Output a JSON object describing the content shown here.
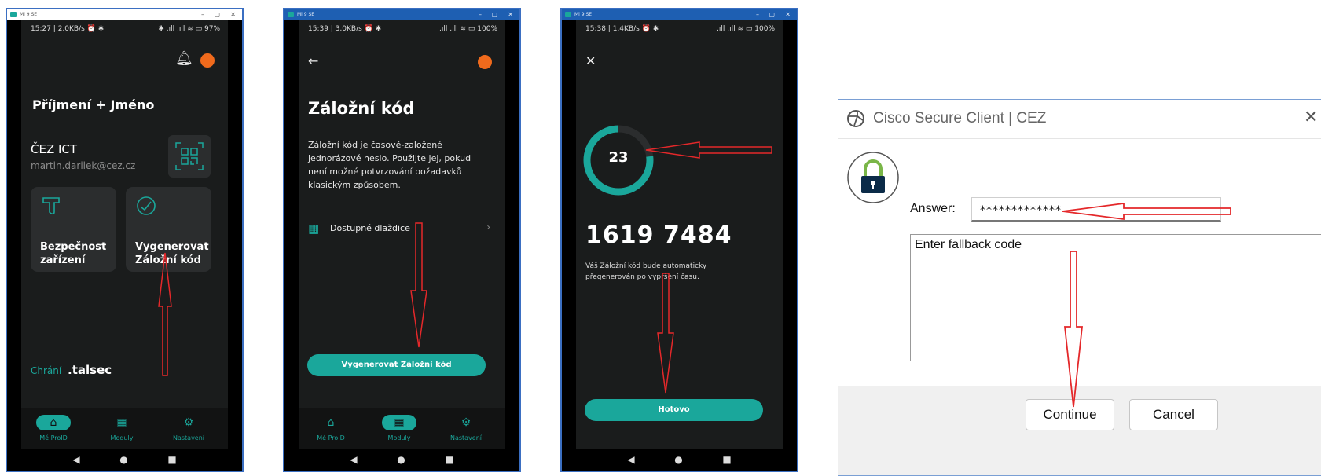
{
  "phone1": {
    "window_title": "Mi 9 SE",
    "status_left": "15:27 | 2,0KB/s ⏰ ✱",
    "status_right": "✱ .ıll .ıll ≋ ▭ 97%",
    "user_name": "Příjmení + Jméno",
    "org": "ČEZ ICT",
    "email": "martin.darilek@cez.cz",
    "tile_security": "Bezpečnost\nzařízení",
    "tile_generate": "Vygenerovat\nZáložní kód",
    "protected_by": "Chrání",
    "brand": ".talsec",
    "nav": [
      "Mé ProID",
      "Moduly",
      "Nastavení"
    ]
  },
  "phone2": {
    "window_title": "Mi 9 SE",
    "status_left": "15:39 | 3,0KB/s ⏰ ✱",
    "status_right": ".ıll .ıll ≋ ▭ 100%",
    "title": "Záložní kód",
    "description": "Záložní kód je časově-založené jednorázové heslo. Použijte jej, pokud není možné potvrzování požadavků klasickým způsobem.",
    "tiles_link": "Dostupné dlaždice",
    "button": "Vygenerovat Záložní kód",
    "nav": [
      "Mé ProID",
      "Moduly",
      "Nastavení"
    ]
  },
  "phone3": {
    "window_title": "Mi 9 SE",
    "status_left": "15:38 | 1,4KB/s ⏰ ✱",
    "status_right": ".ıll .ıll ≋ ▭ 100%",
    "countdown": "23",
    "countdown_fraction": 0.77,
    "code": "1619 7484",
    "note": "Váš Záložní kód bude automaticky přegenerován po vypršení času.",
    "button": "Hotovo"
  },
  "dialog": {
    "title": "Cisco Secure Client | CEZ",
    "answer_label": "Answer:",
    "answer_value": "*************",
    "message": "Enter fallback code",
    "continue": "Continue",
    "cancel": "Cancel"
  },
  "colors": {
    "accent": "#1aa79b",
    "orange": "#f06a1c",
    "annotation": "#e4282a",
    "window_frame": "#3b6fc2"
  }
}
